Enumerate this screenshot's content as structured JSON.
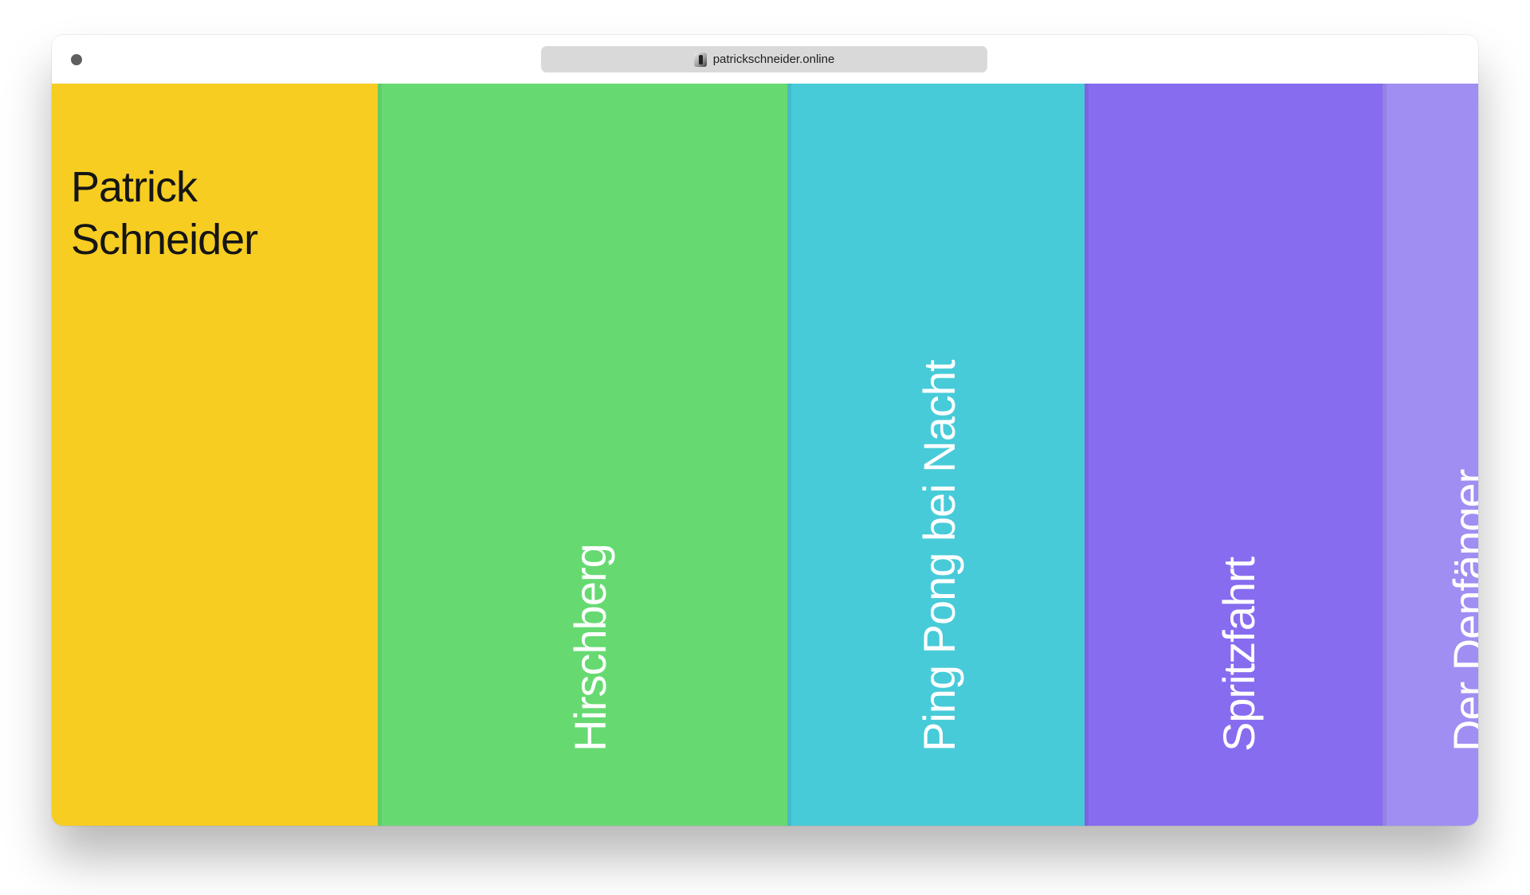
{
  "browser": {
    "url": "patrickschneider.online",
    "favicon_icon": "portrait-favicon-icon",
    "window_dot_color": "#5f5f5f"
  },
  "home": {
    "title": "Patrick\nSchneider",
    "color": "#f7cd22"
  },
  "panels": [
    {
      "label": "Hirschberg",
      "color": "#66da71"
    },
    {
      "label": "Ping Pong bei Nacht",
      "color": "#48cbd9"
    },
    {
      "label": "Spritzfahrt",
      "color": "#876cf0"
    },
    {
      "label": "Der Denfänger",
      "color": "#a18ef2"
    }
  ]
}
